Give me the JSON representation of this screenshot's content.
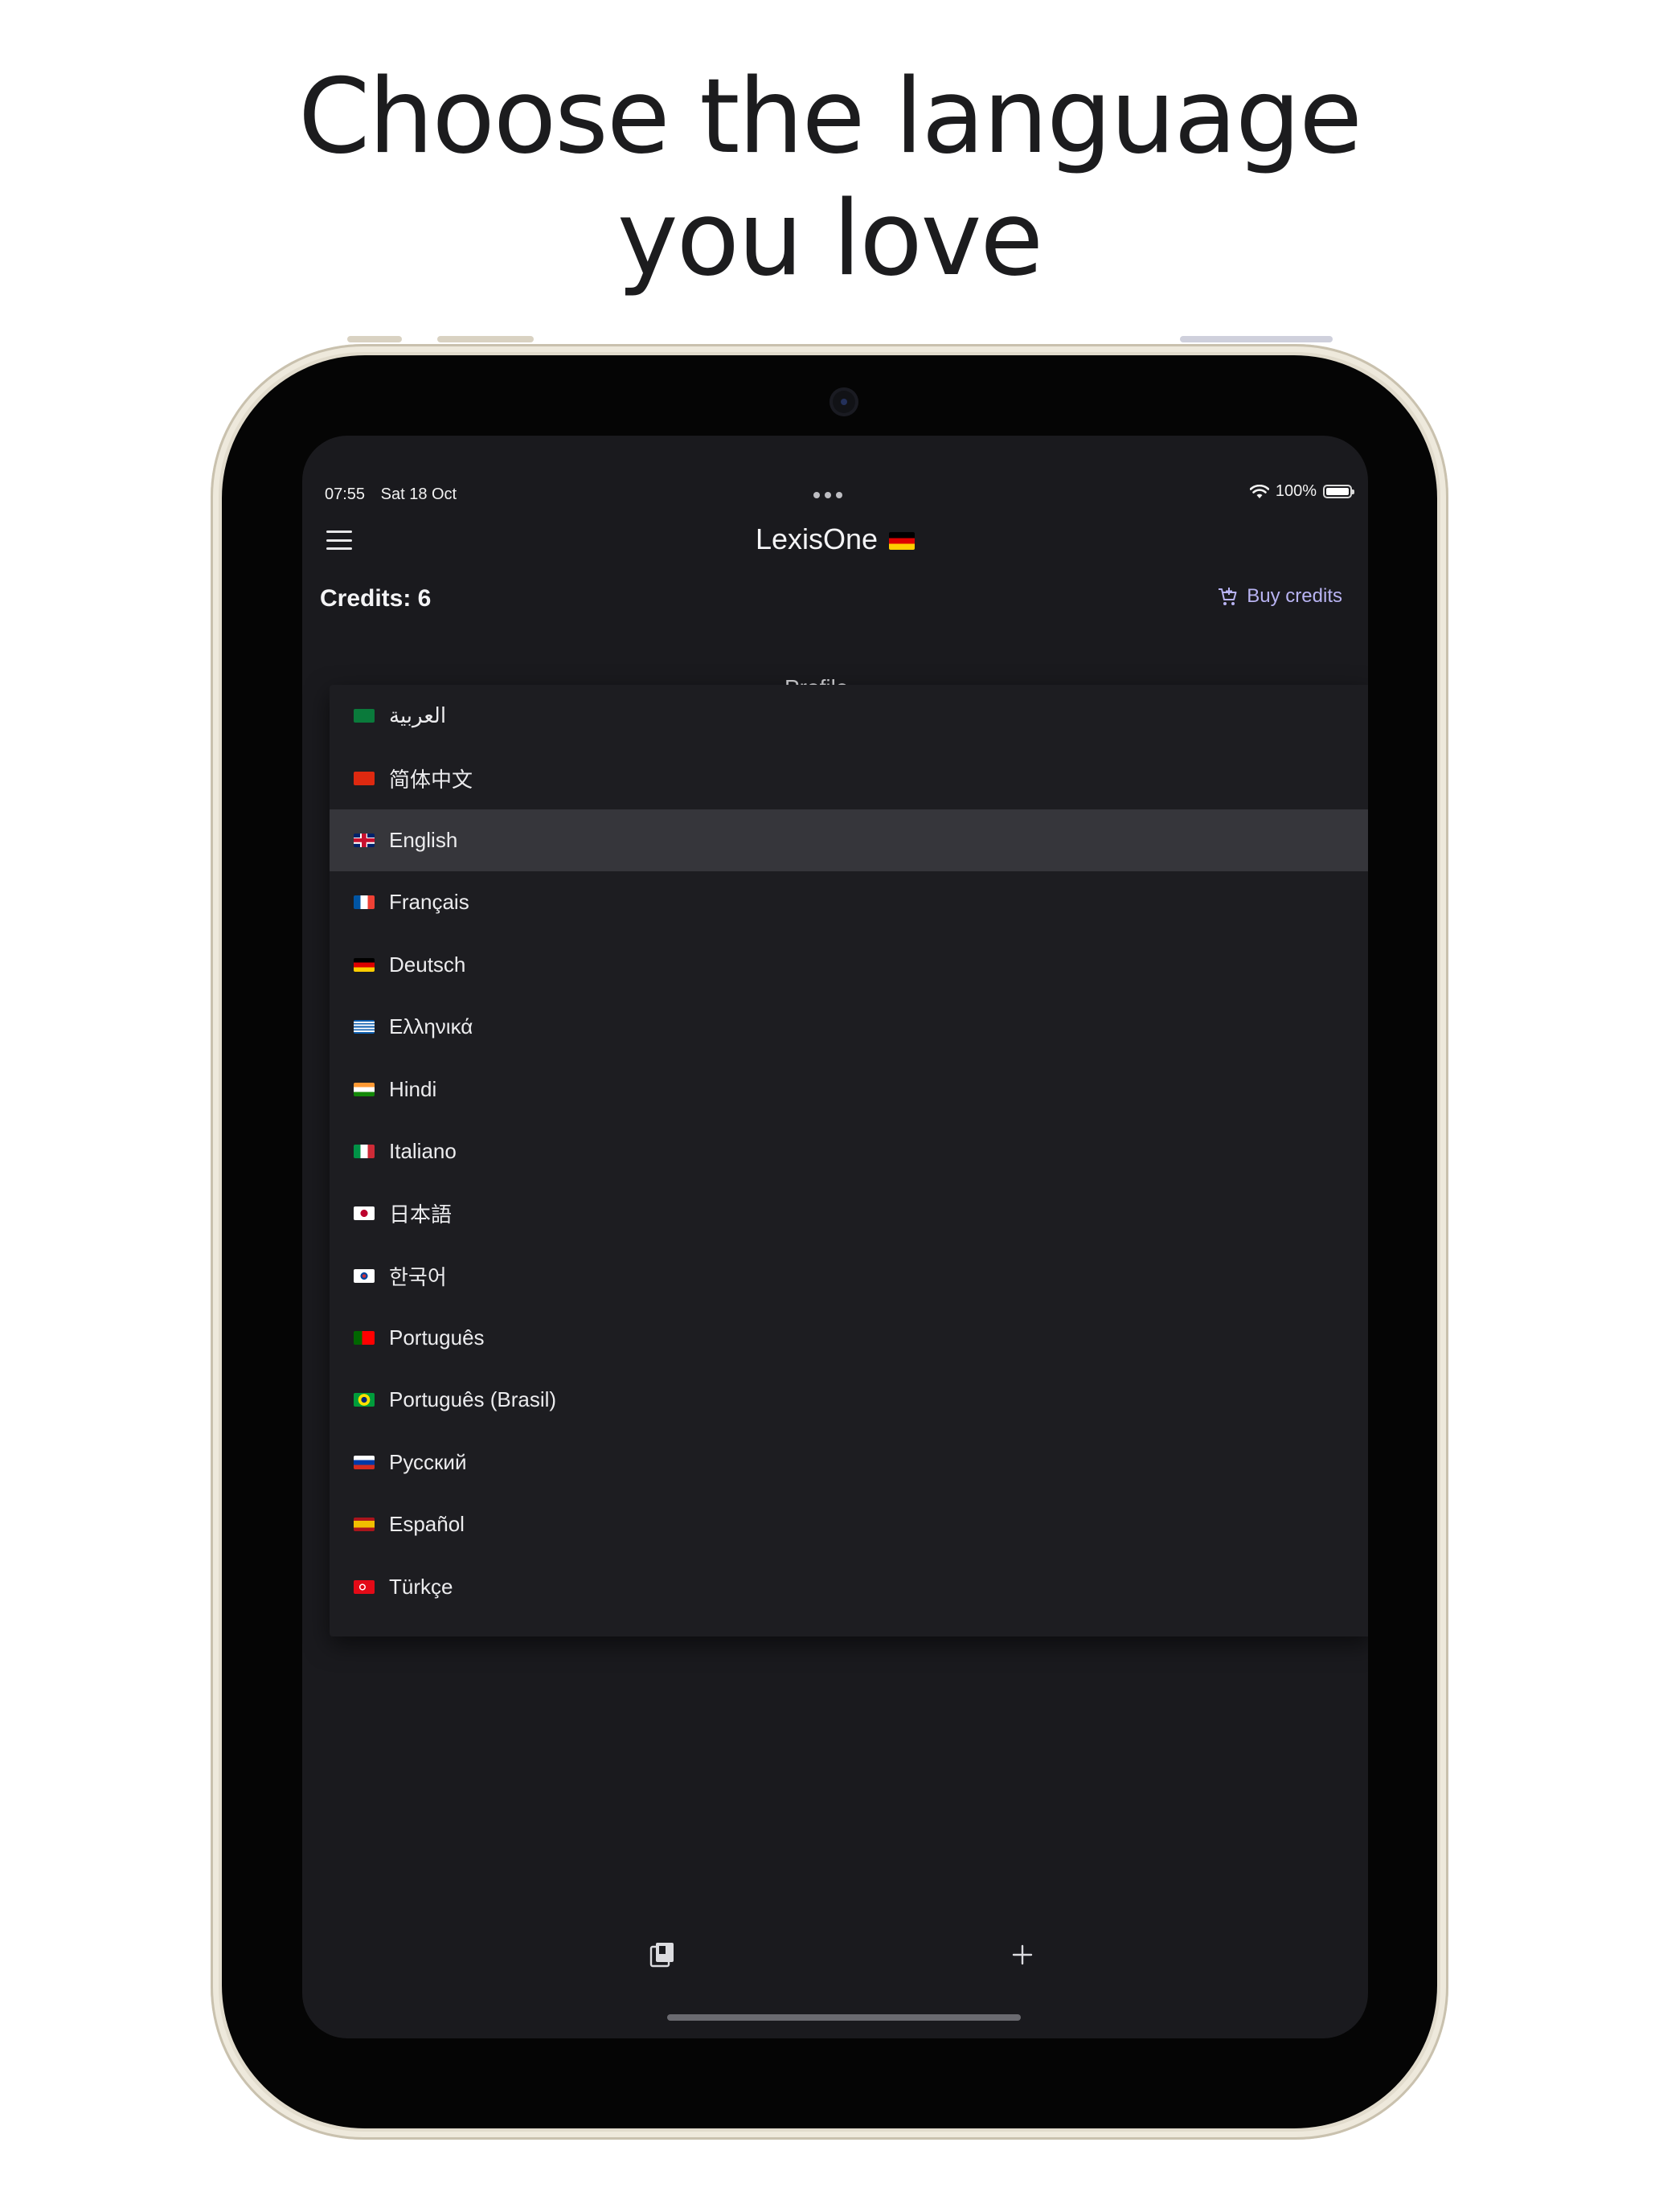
{
  "headline": {
    "line1": "Choose the language",
    "line2": "you love"
  },
  "status_bar": {
    "time": "07:55",
    "date": "Sat 18 Oct",
    "battery": "100%"
  },
  "app_bar": {
    "title": "LexisOne"
  },
  "credits": {
    "label": "Credits: 6",
    "buy_label": "Buy credits"
  },
  "background_title": "Profile",
  "languages": [
    {
      "label": "العربية",
      "flag": "flag-saudi-arabia"
    },
    {
      "label": "简体中文",
      "flag": "flag-china"
    },
    {
      "label": "English",
      "flag": "flag-uk",
      "selected": true
    },
    {
      "label": "Français",
      "flag": "flag-france"
    },
    {
      "label": "Deutsch",
      "flag": "flag-germany"
    },
    {
      "label": "Ελληνικά",
      "flag": "flag-greece"
    },
    {
      "label": "Hindi",
      "flag": "flag-india"
    },
    {
      "label": "Italiano",
      "flag": "flag-italy"
    },
    {
      "label": "日本語",
      "flag": "flag-japan"
    },
    {
      "label": "한국어",
      "flag": "flag-korea"
    },
    {
      "label": "Português",
      "flag": "flag-portugal"
    },
    {
      "label": "Português (Brasil)",
      "flag": "flag-brazil"
    },
    {
      "label": "Русский",
      "flag": "flag-russia"
    },
    {
      "label": "Español",
      "flag": "flag-spain"
    },
    {
      "label": "Türkçe",
      "flag": "flag-turkey"
    }
  ],
  "bottom_nav": [
    "library-icon",
    "add-icon",
    "profile-icon"
  ],
  "colors": {
    "screen_bg": "#1a1a1e",
    "menu_bg": "#1d1d21",
    "selected_bg": "#36363b",
    "accent": "#b8b3f2"
  }
}
